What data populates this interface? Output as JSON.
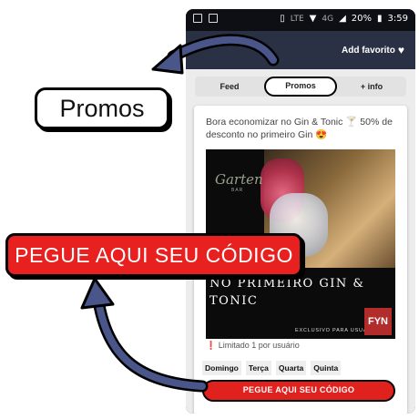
{
  "status_bar": {
    "battery": "20%",
    "time": "3:59",
    "network": "4G",
    "lte": "LTE"
  },
  "header": {
    "favorite_label": "Add favorito"
  },
  "tabs": [
    {
      "label": "Feed",
      "active": false
    },
    {
      "label": "Promos",
      "active": true
    },
    {
      "label": "+ info",
      "active": false
    }
  ],
  "promo": {
    "description": "Bora economizar no Gin & Tonic 🍸 50% de desconto no primeiro Gin 😍",
    "banner": {
      "logo": "Garten",
      "logo_sub": "BAR",
      "headline": "NO PRIMEIRO GIN & TONIC",
      "footer": "EXCLUSIVO PARA USUÁRIOS",
      "badge": "FYN"
    },
    "limit_text": "Limitado 1 por usuário",
    "days": [
      "Domingo",
      "Terça",
      "Quarta",
      "Quinta"
    ],
    "cta_label": "PEGUE AQUI SEU CÓDIGO"
  },
  "callouts": {
    "promos": "Promos",
    "cta": "PEGUE AQUI SEU CÓDIGO"
  },
  "colors": {
    "accent_red": "#e0211e",
    "appbar": "#2a3144",
    "arrow": "#4a5689"
  }
}
